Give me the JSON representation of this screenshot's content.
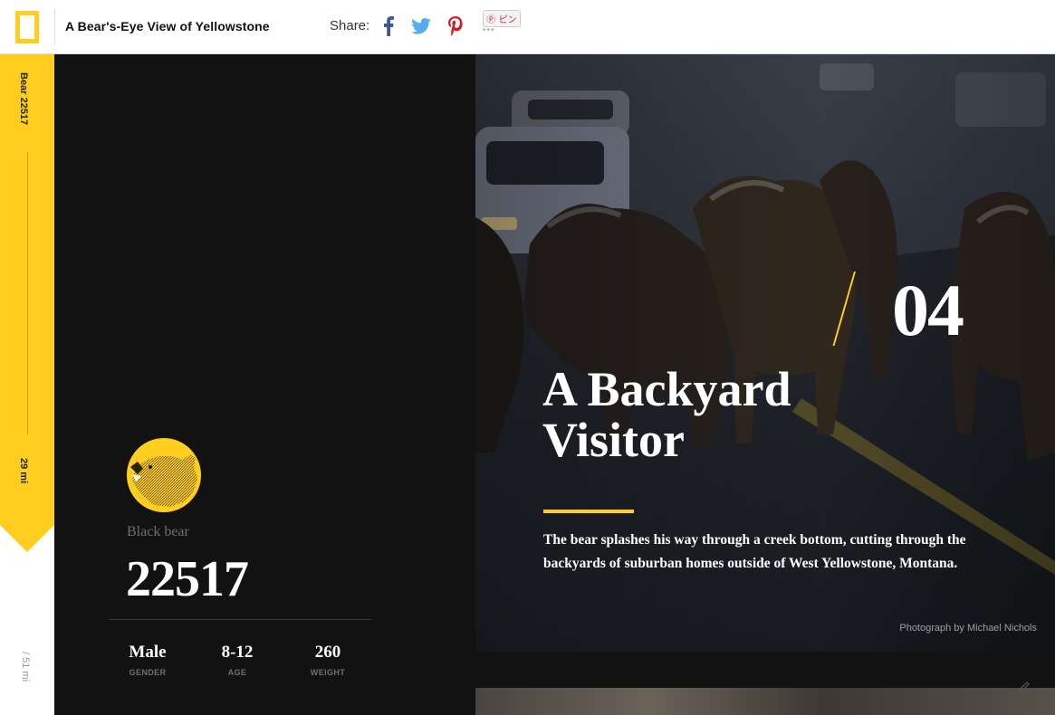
{
  "header": {
    "site_title": "A Bear's-Eye View of Yellowstone",
    "share_label": "Share:",
    "share_icons": [
      "facebook-icon",
      "twitter-icon",
      "pinterest-icon"
    ],
    "pin_button": "Ⓟ ピン",
    "pin_dots": "•••"
  },
  "rail": {
    "bear_label": "Bear 22517",
    "distance": "29 mi",
    "total": "/ 51 mi",
    "accent_color": "#FFCE1F"
  },
  "bear": {
    "species": "Black bear",
    "id": "22517",
    "stats": [
      {
        "value": "Male",
        "label": "GENDER"
      },
      {
        "value": "8-12",
        "label": "AGE"
      },
      {
        "value": "260",
        "label": "WEIGHT"
      }
    ]
  },
  "chapter": {
    "number": "04",
    "title": "A Backyard Visitor",
    "description": "The bear splashes his way through a creek bottom, cutting through the backyards of suburban homes outside of West Yellowstone, Montana.",
    "credit": "Photograph by Michael Nichols"
  }
}
